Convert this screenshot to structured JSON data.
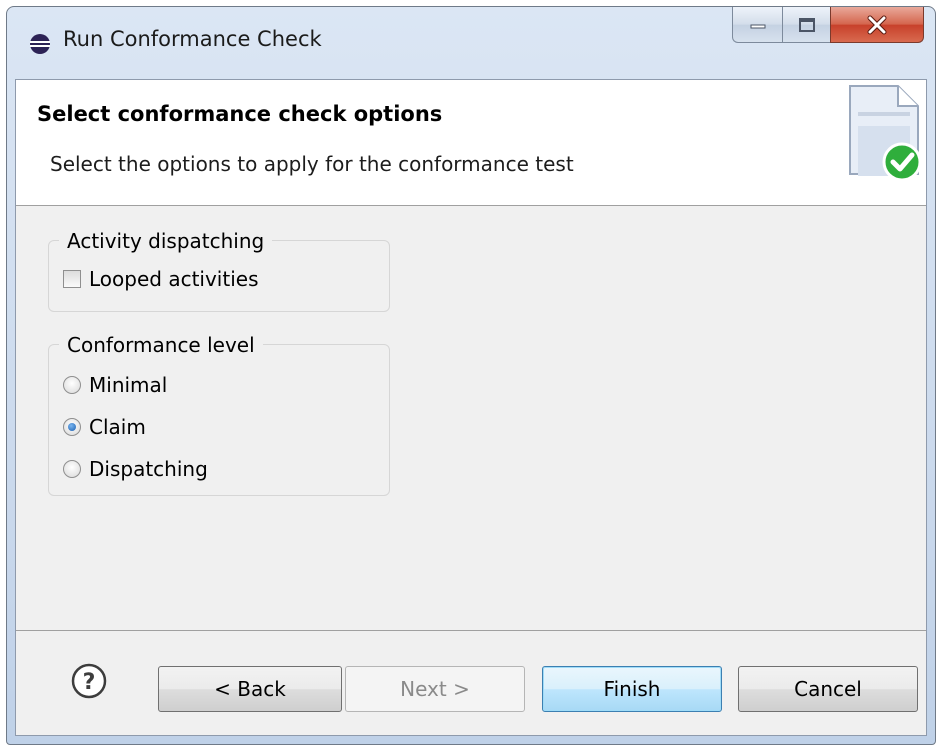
{
  "window": {
    "title": "Run Conformance Check",
    "controls": [
      "minimize",
      "maximize",
      "close"
    ]
  },
  "banner": {
    "title": "Select conformance check options",
    "description": "Select the options to apply for the conformance test"
  },
  "groups": {
    "activity_dispatching": {
      "legend": "Activity dispatching",
      "options": [
        {
          "label": "Looped activities",
          "checked": false
        }
      ]
    },
    "conformance_level": {
      "legend": "Conformance level",
      "options": [
        {
          "label": "Minimal",
          "selected": false
        },
        {
          "label": "Claim",
          "selected": true
        },
        {
          "label": "Dispatching",
          "selected": false
        }
      ]
    }
  },
  "buttons": {
    "back": "< Back",
    "next": "Next >",
    "finish": "Finish",
    "cancel": "Cancel"
  },
  "colors": {
    "close_button": "#c7402a",
    "selected_radio": "#1b5fb0",
    "default_button_border": "#3c7fb1",
    "check_badge": "#2fae3c"
  }
}
